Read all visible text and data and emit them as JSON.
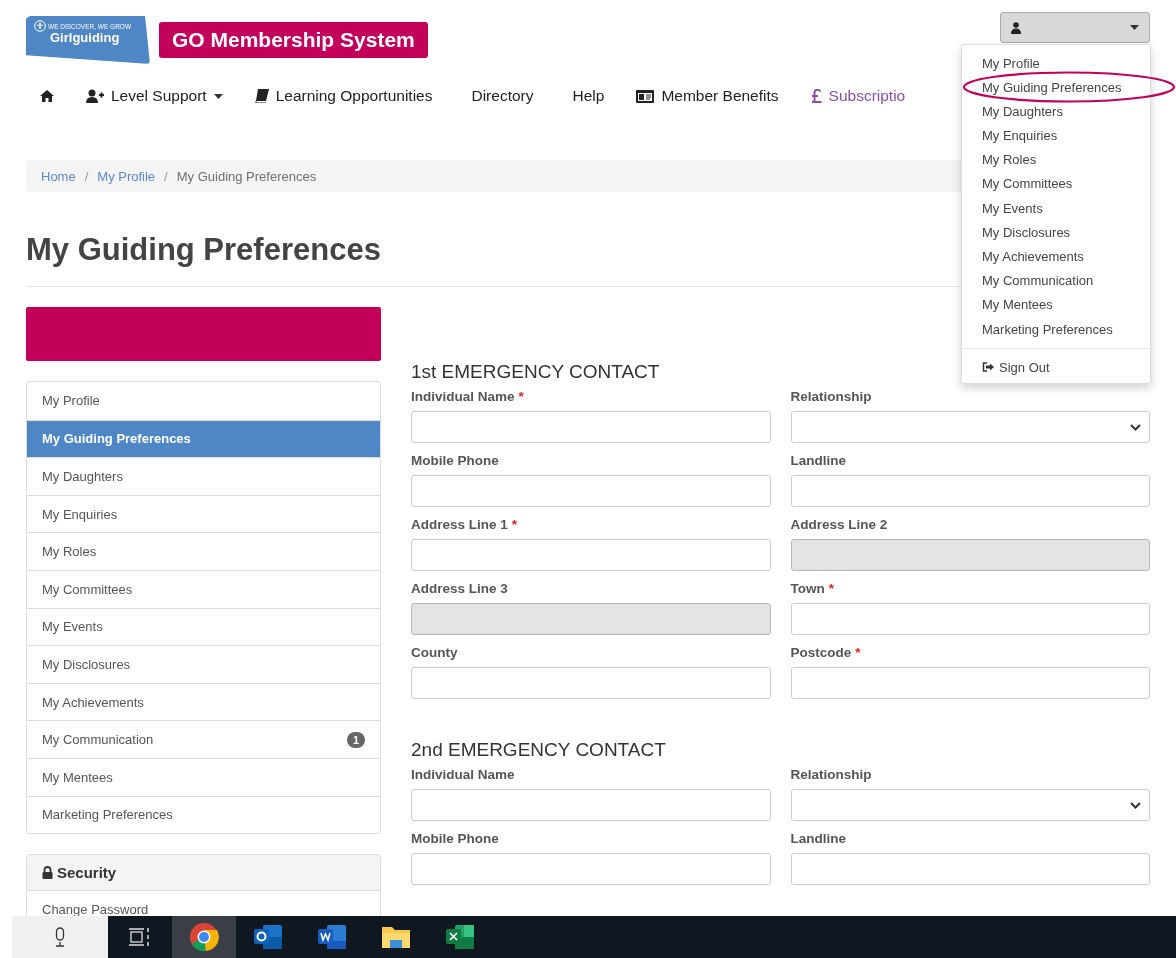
{
  "header": {
    "logo": {
      "tagline": "WE DISCOVER, WE GROW",
      "name": "Girlguiding"
    },
    "app_title": "GO Membership System",
    "user_menu": {
      "expanded": true
    }
  },
  "nav": [
    {
      "kind": "home"
    },
    {
      "kind": "menu",
      "label": "Level Support"
    },
    {
      "kind": "link",
      "label": "Learning Opportunities"
    },
    {
      "kind": "link",
      "label": "Directory"
    },
    {
      "kind": "link",
      "label": "Help"
    },
    {
      "kind": "link",
      "label": "Member Benefits"
    },
    {
      "kind": "accent",
      "label": "Subscriptio"
    }
  ],
  "user_dropdown": [
    {
      "kind": "item",
      "label": "My Profile"
    },
    {
      "kind": "item",
      "label": "My Guiding Preferences"
    },
    {
      "kind": "item",
      "label": "My Daughters"
    },
    {
      "kind": "item",
      "label": "My Enquiries"
    },
    {
      "kind": "item",
      "label": "My Roles"
    },
    {
      "kind": "item",
      "label": "My Committees"
    },
    {
      "kind": "item",
      "label": "My Events"
    },
    {
      "kind": "item",
      "label": "My Disclosures"
    },
    {
      "kind": "item",
      "label": "My Achievements"
    },
    {
      "kind": "item",
      "label": "My Communication"
    },
    {
      "kind": "item",
      "label": "My Mentees"
    },
    {
      "kind": "item",
      "label": "Marketing Preferences"
    },
    {
      "kind": "sign_out",
      "label": "Sign Out"
    }
  ],
  "breadcrumb": [
    {
      "label": "Home",
      "link": true
    },
    {
      "separator": "/",
      "label": "My Profile",
      "link": true
    },
    {
      "separator": "/",
      "label": "My Guiding Preferences",
      "link": false
    }
  ],
  "title": "My Guiding Preferences",
  "sidebar": {
    "items": [
      {
        "label": "My Profile",
        "selected": false
      },
      {
        "label": "My Guiding Preferences",
        "selected": true
      },
      {
        "label": "My Daughters",
        "selected": false
      },
      {
        "label": "My Enquiries",
        "selected": false
      },
      {
        "label": "My Roles",
        "selected": false
      },
      {
        "label": "My Committees",
        "selected": false
      },
      {
        "label": "My Events",
        "selected": false
      },
      {
        "label": "My Disclosures",
        "selected": false
      },
      {
        "label": "My Achievements",
        "selected": false
      },
      {
        "label": "My Communication",
        "selected": false,
        "badge": "1"
      },
      {
        "label": "My Mentees",
        "selected": false
      },
      {
        "label": "Marketing Preferences",
        "selected": false
      }
    ],
    "security": {
      "title": "Security",
      "items": [
        {
          "label": "Change Password"
        }
      ]
    }
  },
  "sections": [
    {
      "title": "1st EMERGENCY CONTACT",
      "fields": [
        {
          "label": "Individual Name",
          "required_mark": "*",
          "kind": "text",
          "disabled": false
        },
        {
          "label": "Relationship",
          "kind": "select",
          "disabled": false
        },
        {
          "label": "Mobile Phone",
          "kind": "text",
          "disabled": false
        },
        {
          "label": "Landline",
          "kind": "text",
          "disabled": false
        },
        {
          "label": "Address Line 1",
          "required_mark": "*",
          "kind": "text",
          "disabled": false
        },
        {
          "label": "Address Line 2",
          "kind": "text",
          "disabled": true
        },
        {
          "label": "Address Line 3",
          "kind": "text",
          "disabled": true
        },
        {
          "label": "Town",
          "required_mark": "*",
          "kind": "text",
          "disabled": false
        },
        {
          "label": "County",
          "kind": "text",
          "disabled": false
        },
        {
          "label": "Postcode",
          "required_mark": "*",
          "kind": "text",
          "disabled": false
        }
      ]
    },
    {
      "title": "2nd EMERGENCY CONTACT",
      "fields": [
        {
          "label": "Individual Name",
          "kind": "text",
          "disabled": false
        },
        {
          "label": "Relationship",
          "kind": "select",
          "disabled": false
        },
        {
          "label": "Mobile Phone",
          "kind": "text",
          "disabled": false
        },
        {
          "label": "Landline",
          "kind": "text",
          "disabled": false
        }
      ]
    }
  ]
}
